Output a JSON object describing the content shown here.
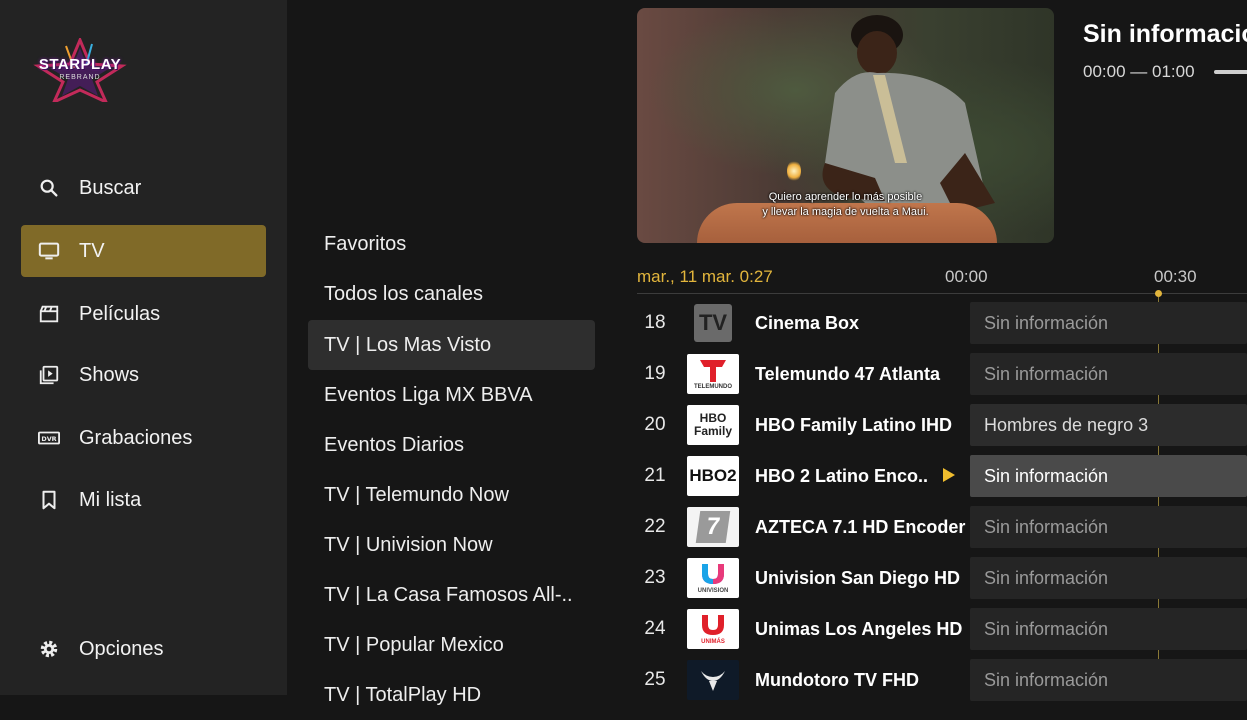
{
  "sidebar": {
    "logo": {
      "name": "STARPLAY",
      "subtitle": "REBRAND"
    },
    "items": [
      {
        "label": "Buscar",
        "icon": "search-icon"
      },
      {
        "label": "TV",
        "icon": "tv-icon",
        "active": true
      },
      {
        "label": "Películas",
        "icon": "clapperboard-icon"
      },
      {
        "label": "Shows",
        "icon": "play-library-icon"
      },
      {
        "label": "Grabaciones",
        "icon": "dvr-icon"
      },
      {
        "label": "Mi lista",
        "icon": "bookmark-icon"
      }
    ],
    "options": {
      "label": "Opciones",
      "icon": "gear-icon"
    }
  },
  "categories": [
    {
      "label": "Favoritos"
    },
    {
      "label": "Todos los canales"
    },
    {
      "label": "TV | Los Mas Visto",
      "active": true
    },
    {
      "label": "Eventos Liga MX BBVA"
    },
    {
      "label": "Eventos Diarios"
    },
    {
      "label": "TV | Telemundo Now"
    },
    {
      "label": "TV | Univision Now"
    },
    {
      "label": "TV | La Casa Famosos All-.."
    },
    {
      "label": "TV | Popular Mexico"
    },
    {
      "label": "TV | TotalPlay HD"
    }
  ],
  "preview": {
    "subtitle_line1": "Quiero aprender lo más posible",
    "subtitle_line2": "y llevar la magia de vuelta a Maui."
  },
  "program": {
    "title": "Sin informació",
    "time": "00:00 — 01:00"
  },
  "timeline": {
    "date": "mar., 11 mar. 0:27",
    "marks": [
      "00:00",
      "00:30"
    ]
  },
  "channels": [
    {
      "number": "18",
      "name": "Cinema Box",
      "program": "Sin información",
      "logo_text": "TV"
    },
    {
      "number": "19",
      "name": "Telemundo 47 Atlanta",
      "program": "Sin información",
      "logo_text": "TELEMUNDO"
    },
    {
      "number": "20",
      "name": "HBO Family Latino IHD",
      "program": "Hombres de negro 3",
      "logo_text": "HBO Family"
    },
    {
      "number": "21",
      "name": "HBO 2 Latino Enco..",
      "program": "Sin información",
      "logo_text": "HBO2"
    },
    {
      "number": "22",
      "name": "AZTECA 7.1 HD Encoder",
      "program": "Sin información",
      "logo_text": "7"
    },
    {
      "number": "23",
      "name": "Univision San Diego HD",
      "program": "Sin información",
      "logo_text": "UNIVISION"
    },
    {
      "number": "24",
      "name": "Unimas Los Angeles HD",
      "program": "Sin información",
      "logo_text": "UNIMÁS"
    },
    {
      "number": "25",
      "name": "Mundotoro TV FHD",
      "program": "Sin información",
      "logo_text": ""
    }
  ],
  "colors": {
    "accent": "#806a28",
    "timeline_accent": "#e2b53c",
    "background": "#161616",
    "sidebar": "#232323"
  }
}
